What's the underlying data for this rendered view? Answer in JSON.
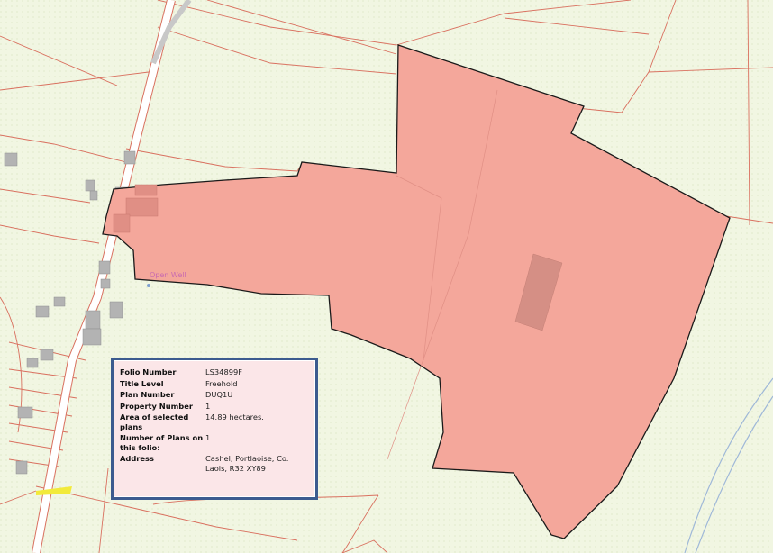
{
  "map": {
    "labels": {
      "open_well": "Open Well"
    },
    "colors": {
      "land_background": "#f1f6e2",
      "parcel_fill": "#f4a79b",
      "parcel_outline": "#1a1a1a",
      "boundary_line": "#d9705f",
      "road_casing": "#d9705f",
      "road_fill": "#ffffff",
      "building": "#b3b3b3",
      "river": "#9fb8d8",
      "label_pink": "#c86ab0",
      "yellow_patch": "#f2ea3a"
    }
  },
  "popup": {
    "rows": [
      {
        "key": "Folio Number",
        "value": "LS34899F"
      },
      {
        "key": "Title Level",
        "value": "Freehold"
      },
      {
        "key": "Plan Number",
        "value": "DUQ1U"
      },
      {
        "key": "Property Number",
        "value": "1"
      },
      {
        "key": "Area of selected plans",
        "value": "14.89 hectares."
      },
      {
        "key": "Number of Plans on this folio:",
        "value": "1"
      },
      {
        "key": "Address",
        "value": "Cashel, Portlaoise, Co. Laois, R32 XY89"
      }
    ],
    "colors": {
      "background": "#fbe6e8",
      "border": "#3c5b8f"
    }
  }
}
